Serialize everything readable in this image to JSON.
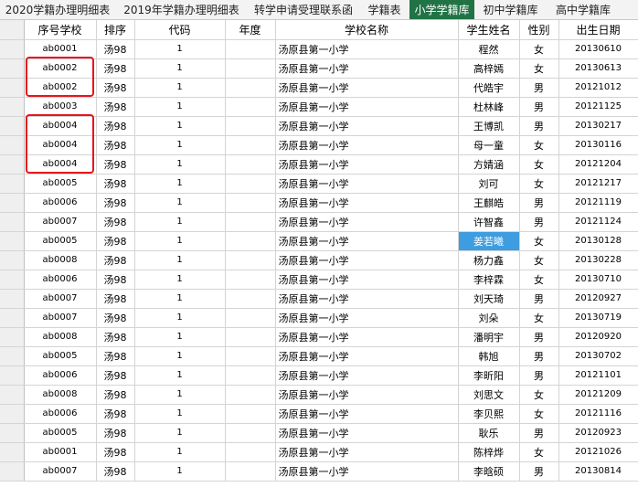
{
  "sheet_tabs": [
    "2020学籍办理明细表",
    "2019年学籍办理明细表",
    "转学申请受理联系函",
    "学籍表",
    "小学学籍库",
    "初中学籍库",
    "高中学籍库"
  ],
  "active_tab_index": 4,
  "colors": {
    "active_tab": "#217346",
    "selected_cell": "#3d9de0",
    "highlight_box": "#e8141c"
  },
  "columns": [
    "序号学校",
    "排序",
    "代码",
    "年度",
    "学校名称",
    "学生姓名",
    "性别",
    "出生日期"
  ],
  "rows": [
    [
      "ab0001",
      "汤98",
      "1",
      "",
      "汤原县第一小学",
      "程然",
      "女",
      "20130610"
    ],
    [
      "ab0002",
      "汤98",
      "1",
      "",
      "汤原县第一小学",
      "高梓嫣",
      "女",
      "20130613"
    ],
    [
      "ab0002",
      "汤98",
      "1",
      "",
      "汤原县第一小学",
      "代皓宇",
      "男",
      "20121012"
    ],
    [
      "ab0003",
      "汤98",
      "1",
      "",
      "汤原县第一小学",
      "杜林峰",
      "男",
      "20121125"
    ],
    [
      "ab0004",
      "汤98",
      "1",
      "",
      "汤原县第一小学",
      "王博凯",
      "男",
      "20130217"
    ],
    [
      "ab0004",
      "汤98",
      "1",
      "",
      "汤原县第一小学",
      "母一童",
      "女",
      "20130116"
    ],
    [
      "ab0004",
      "汤98",
      "1",
      "",
      "汤原县第一小学",
      "方婧涵",
      "女",
      "20121204"
    ],
    [
      "ab0005",
      "汤98",
      "1",
      "",
      "汤原县第一小学",
      "刘可",
      "女",
      "20121217"
    ],
    [
      "ab0006",
      "汤98",
      "1",
      "",
      "汤原县第一小学",
      "王麒皓",
      "男",
      "20121119"
    ],
    [
      "ab0007",
      "汤98",
      "1",
      "",
      "汤原县第一小学",
      "许智鑫",
      "男",
      "20121124"
    ],
    [
      "ab0005",
      "汤98",
      "1",
      "",
      "汤原县第一小学",
      "姜若曦",
      "女",
      "20130128"
    ],
    [
      "ab0008",
      "汤98",
      "1",
      "",
      "汤原县第一小学",
      "杨力鑫",
      "女",
      "20130228"
    ],
    [
      "ab0006",
      "汤98",
      "1",
      "",
      "汤原县第一小学",
      "李梓霖",
      "女",
      "20130710"
    ],
    [
      "ab0007",
      "汤98",
      "1",
      "",
      "汤原县第一小学",
      "刘天琦",
      "男",
      "20120927"
    ],
    [
      "ab0007",
      "汤98",
      "1",
      "",
      "汤原县第一小学",
      "刘朵",
      "女",
      "20130719"
    ],
    [
      "ab0008",
      "汤98",
      "1",
      "",
      "汤原县第一小学",
      "潘明宇",
      "男",
      "20120920"
    ],
    [
      "ab0005",
      "汤98",
      "1",
      "",
      "汤原县第一小学",
      "韩旭",
      "男",
      "20130702"
    ],
    [
      "ab0006",
      "汤98",
      "1",
      "",
      "汤原县第一小学",
      "李昕阳",
      "男",
      "20121101"
    ],
    [
      "ab0008",
      "汤98",
      "1",
      "",
      "汤原县第一小学",
      "刘思文",
      "女",
      "20121209"
    ],
    [
      "ab0006",
      "汤98",
      "1",
      "",
      "汤原县第一小学",
      "李贝熙",
      "女",
      "20121116"
    ],
    [
      "ab0005",
      "汤98",
      "1",
      "",
      "汤原县第一小学",
      "耿乐",
      "男",
      "20120923"
    ],
    [
      "ab0001",
      "汤98",
      "1",
      "",
      "汤原县第一小学",
      "陈梓烨",
      "女",
      "20121026"
    ],
    [
      "ab0007",
      "汤98",
      "1",
      "",
      "汤原县第一小学",
      "李晗硕",
      "男",
      "20130814"
    ]
  ],
  "selected_cell": {
    "row": 10,
    "col": 5
  },
  "highlight_groups": [
    {
      "rows": [
        1,
        2
      ]
    },
    {
      "rows": [
        4,
        6
      ]
    }
  ]
}
